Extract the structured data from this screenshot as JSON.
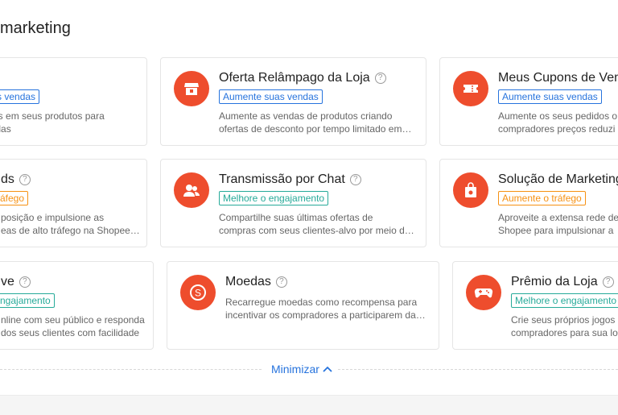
{
  "section": {
    "title": "marketing"
  },
  "cards": [
    {
      "title": "",
      "badge": "tos vendas",
      "desc": "utos em seus produtos para\nendas"
    },
    {
      "title": "Oferta Relâmpago da Loja",
      "badge": "Aumente suas vendas",
      "desc": "Aumente as vendas de produtos criando\nofertas de desconto por tempo limitado em…"
    },
    {
      "title": "Meus Cupons de Ven",
      "badge": "Aumente suas vendas",
      "desc": "Aumente os seus pedidos o\ncompradores preços reduzi"
    },
    {
      "title": "ds",
      "badge": "áfego",
      "desc": "posição e impulsione as\neas de alto tráfego na Shopee…"
    },
    {
      "title": "Transmissão por Chat",
      "badge": "Melhore o engajamento",
      "desc": "Compartilhe suas últimas ofertas de\ncompras com seus clientes-alvo por meio d…"
    },
    {
      "title": "Solução de Marketing",
      "badge": "Aumente o tráfego",
      "desc": "Aproveite a extensa rede de\nShopee para impulsionar a"
    },
    {
      "title": "ve",
      "badge": "ngajamento",
      "desc": "nline com seu público e responda\ndos seus clientes com facilidade"
    },
    {
      "title": "Moedas",
      "badge": "",
      "desc": "Recarregue moedas como recompensa para\nincentivar os compradores a participarem da…"
    },
    {
      "title": "Prêmio da Loja",
      "badge": "Melhore o engajamento",
      "desc": "Crie seus próprios jogos\ncompradores para sua lo"
    }
  ],
  "minimize": {
    "label": "Minimizar"
  },
  "icons": {
    "flash-sale": "store-icon",
    "coupon": "ticket-icon",
    "chat": "users-icon",
    "marketing": "bag-icon",
    "coins": "coin-icon",
    "prize": "gamepad-icon"
  },
  "colors": {
    "accent": "#ee4d2d",
    "blue": "#2673dd",
    "teal": "#26aa99",
    "orange": "#f69113"
  }
}
